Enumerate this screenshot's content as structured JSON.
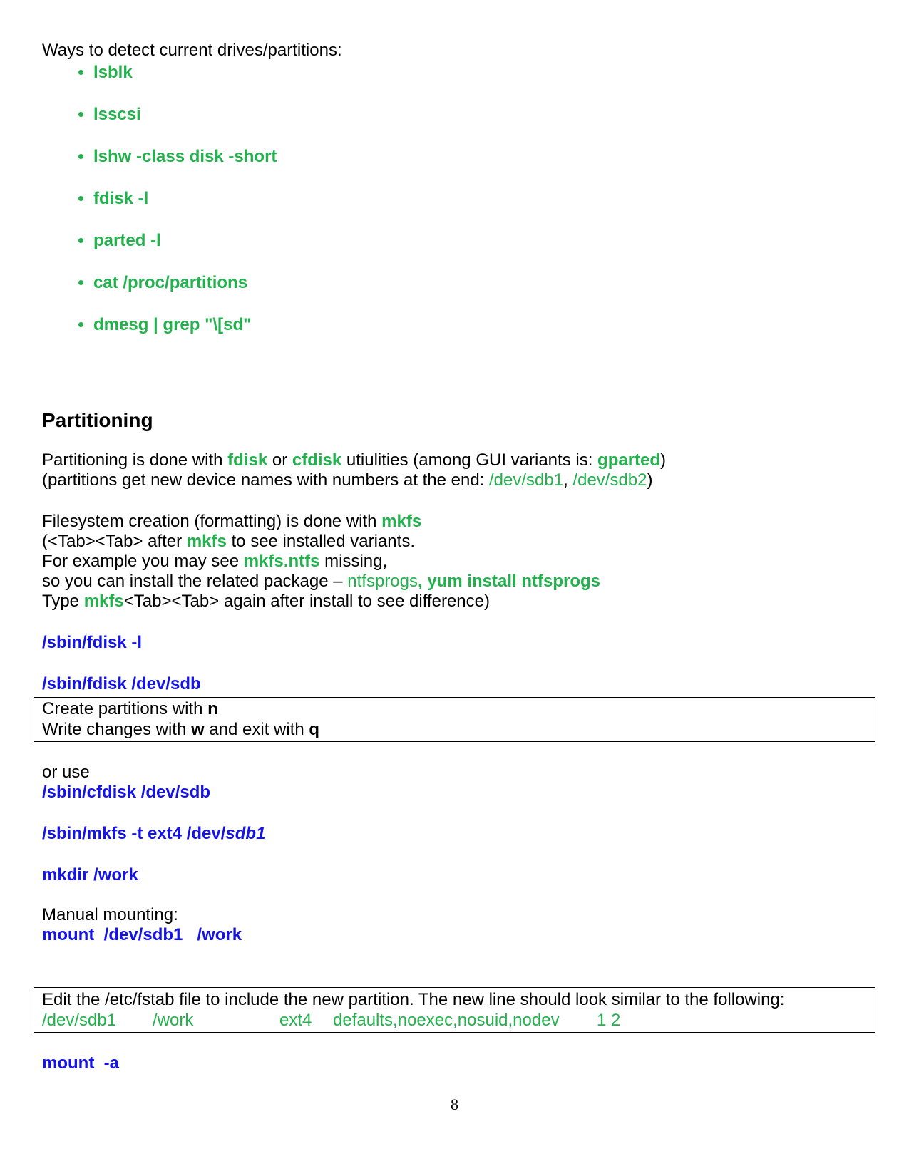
{
  "intro": "Ways to detect current drives/partitions:",
  "commands": [
    "lsblk",
    "lsscsi",
    "lshw -class disk -short",
    "fdisk -l",
    "parted -l",
    "cat /proc/partitions",
    "dmesg | grep \"\\[sd\""
  ],
  "section_title": "Partitioning",
  "p1": {
    "a": "Partitioning is done with ",
    "b": "fdisk",
    "c": " or ",
    "d": "cfdisk",
    "e": " utiulities (among GUI variants is: ",
    "f": "gparted",
    "g": ")"
  },
  "p2": {
    "a": "(partitions get new device names with numbers at the end: ",
    "b": "/dev/sdb1",
    "c": ", ",
    "d": "/dev/sdb2",
    "e": ")"
  },
  "p3": {
    "a": "Filesystem creation (formatting) is done with ",
    "b": "mkfs"
  },
  "p4": {
    "a": "(<Tab><Tab> after ",
    "b": "mkfs",
    "c": " to see installed variants."
  },
  "p5": {
    "a": "For example you may see ",
    "b": "mkfs.ntfs",
    "c": " missing,"
  },
  "p6": {
    "a": "so you can install the related package – ",
    "b": "ntfsprogs",
    "c": ", yum install ntfsprogs"
  },
  "p7": {
    "a": "Type ",
    "b": "mkfs",
    "c": "<Tab><Tab> again after install to see difference)"
  },
  "cmd_fdisk_l": "/sbin/fdisk -l",
  "cmd_fdisk_sdb": "/sbin/fdisk /dev/sdb",
  "box1": {
    "l1a": "Create partitions with ",
    "l1b": "n",
    "l2a": "Write changes with ",
    "l2b": "w",
    "l2c": " and exit with ",
    "l2d": "q"
  },
  "or_use": "or use",
  "cmd_cfdisk": "/sbin/cfdisk /dev/sdb",
  "cmd_mkfs": {
    "a": "/sbin/mkfs -t ext4 /dev/",
    "b": "sdb1"
  },
  "cmd_mkdir": "mkdir /work",
  "manual_mount": "Manual mounting:",
  "cmd_mount": "mount  /dev/sdb1   /work",
  "box2": {
    "text": "Edit the /etc/fstab file to include the new partition. The new line should look similar to the following:",
    "fstab": [
      "/dev/sdb1",
      "/work",
      "ext4",
      "defaults,noexec,nosuid,nodev",
      "1 2"
    ]
  },
  "cmd_mount_a": "mount  -a",
  "page_number": "8"
}
